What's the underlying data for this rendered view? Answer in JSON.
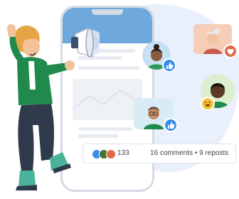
{
  "post_stats": {
    "reaction_count": "133",
    "comments_text": "16 comments",
    "separator": "•",
    "reposts_text": "9 reposts"
  },
  "reaction_icons": [
    "thumbs-up-icon",
    "clapping-hands-icon",
    "heart-icon"
  ],
  "colors": {
    "like_blue": "#378fe9",
    "heart_orange": "#e06847",
    "celebrate_green": "#44712e",
    "shirt_green": "#1f8a4c",
    "phone_header_blue": "#6fa8dc",
    "background_blob": "#e9f0fb"
  }
}
